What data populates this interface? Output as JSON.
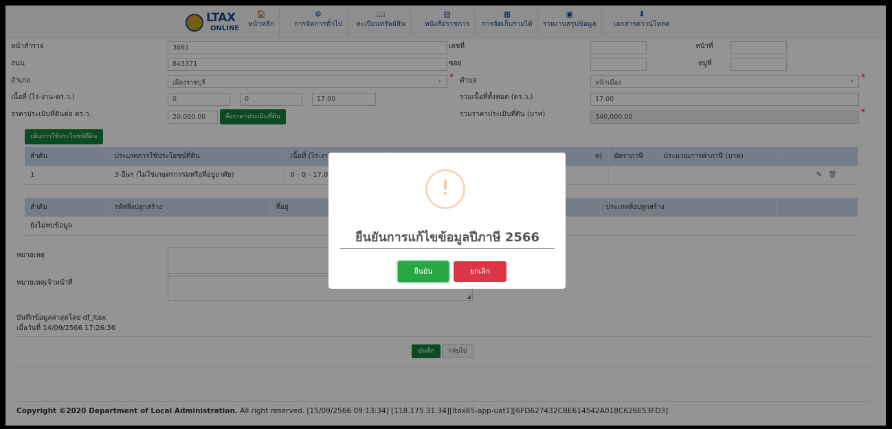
{
  "nav": {
    "logo_text": "LTAX",
    "logo_sub": "ONLINE",
    "items": [
      {
        "label": "หน้าหลัก",
        "icon": "home-icon",
        "glyph": "🏠"
      },
      {
        "label": "การจัดการทั่วไป",
        "icon": "gears-icon",
        "glyph": "⚙"
      },
      {
        "label": "ทะเบียนทรัพย์สิน",
        "icon": "book-icon",
        "glyph": "📖"
      },
      {
        "label": "หนังสือราชการ",
        "icon": "document-icon",
        "glyph": "▤"
      },
      {
        "label": "การจัดเก็บรายได้",
        "icon": "calculator-icon",
        "glyph": "▦"
      },
      {
        "label": "รายงานสรุปข้อมูล",
        "icon": "report-icon",
        "glyph": "▣"
      },
      {
        "label": "เอกสารดาวน์โหลด",
        "icon": "download-icon",
        "glyph": "⬇"
      }
    ]
  },
  "form": {
    "row0": {
      "label_left": "หน้าสำรวจ",
      "value_left": "3681",
      "label_right": "เลขที่",
      "label_right2": "หน้าที่"
    },
    "road": {
      "label": "ถนน",
      "value": "843371",
      "soi_label": "ซอย",
      "moo_label": "หมู่ที่"
    },
    "district": {
      "label": "อำเภอ",
      "value": "เมืองราชบุรี",
      "subdistrict_label": "ตำบล",
      "subdistrict_value": "หน้าเมือง"
    },
    "area": {
      "label": "เนื้อที่ (ไร่-งาน-ตร.ว.)",
      "rai": "0",
      "ngan": "0",
      "wa": "17.00",
      "total_label": "รวมเนื้อที่ทั้งหมด (ตร.ว.)",
      "total_value": "17.00"
    },
    "price": {
      "label": "ราคาประเมินที่ดินต่อ ตร.ว.",
      "value": "20,000.00",
      "button": "ดึงราคาประเมินที่ดิน",
      "total_label": "รวมราคาประเมินที่ดิน (บาท)",
      "total_value": "340,000.00"
    },
    "add_use_button": "เพิ่มการใช้ประโยชน์ที่ดิน"
  },
  "use_table": {
    "headers": [
      "ลำดับ",
      "ประเภทการใช้ประโยชน์ที่ดิน",
      "เนื้อที่ (ไร่-งา",
      "ท)",
      "อัตราภาษี",
      "ประมาณการค่าภาษี (บาท)"
    ],
    "row": {
      "no": "1",
      "type": "3-อื่นๆ (ไม่ใช่เกษตรกรรมหรือที่อยู่อาศัย)",
      "area": "0 - 0 - 17.0"
    }
  },
  "building_table": {
    "headers": [
      "ลำดับ",
      "รหัสสิ่งปลูกสร้าง",
      "ที่อยู่",
      "ประเภทสิ่งปลูกสร้าง"
    ],
    "empty": "ยังไม่พบข้อมูล"
  },
  "notes": {
    "label": "หมายเหตุ",
    "officer_label": "หมายเหตุเจ้าหน้าที่"
  },
  "meta": {
    "saved_by": "บันทึกข้อมูลล่าสุดโดย df_ltax",
    "saved_on": "เมื่อวันที่ 14/09/2566 17:26:36"
  },
  "actions": {
    "save": "บันทึก",
    "back": "กลับไป"
  },
  "footer": {
    "copyright": "Copyright ©2020 Department of Local Administration.",
    "rest": " All right reserved. [15/09/2566 09:13:34] [118.175.31.34][ltax65-app-uat1][6FD627432CBE614542A018C626E53FD3]"
  },
  "modal": {
    "icon": "warning-icon",
    "icon_glyph": "!",
    "title": "ยืนยันการแก้ไขข้อมูลปีภาษี 2566",
    "confirm": "ยืนยัน",
    "cancel": "ยกเลิก"
  },
  "colors": {
    "accent_green": "#15803d",
    "nav_blue": "#1b4b8f",
    "table_header": "#c8d8ea",
    "confirm": "#28a745",
    "cancel": "#dc3545",
    "warning": "#f8bb86"
  }
}
